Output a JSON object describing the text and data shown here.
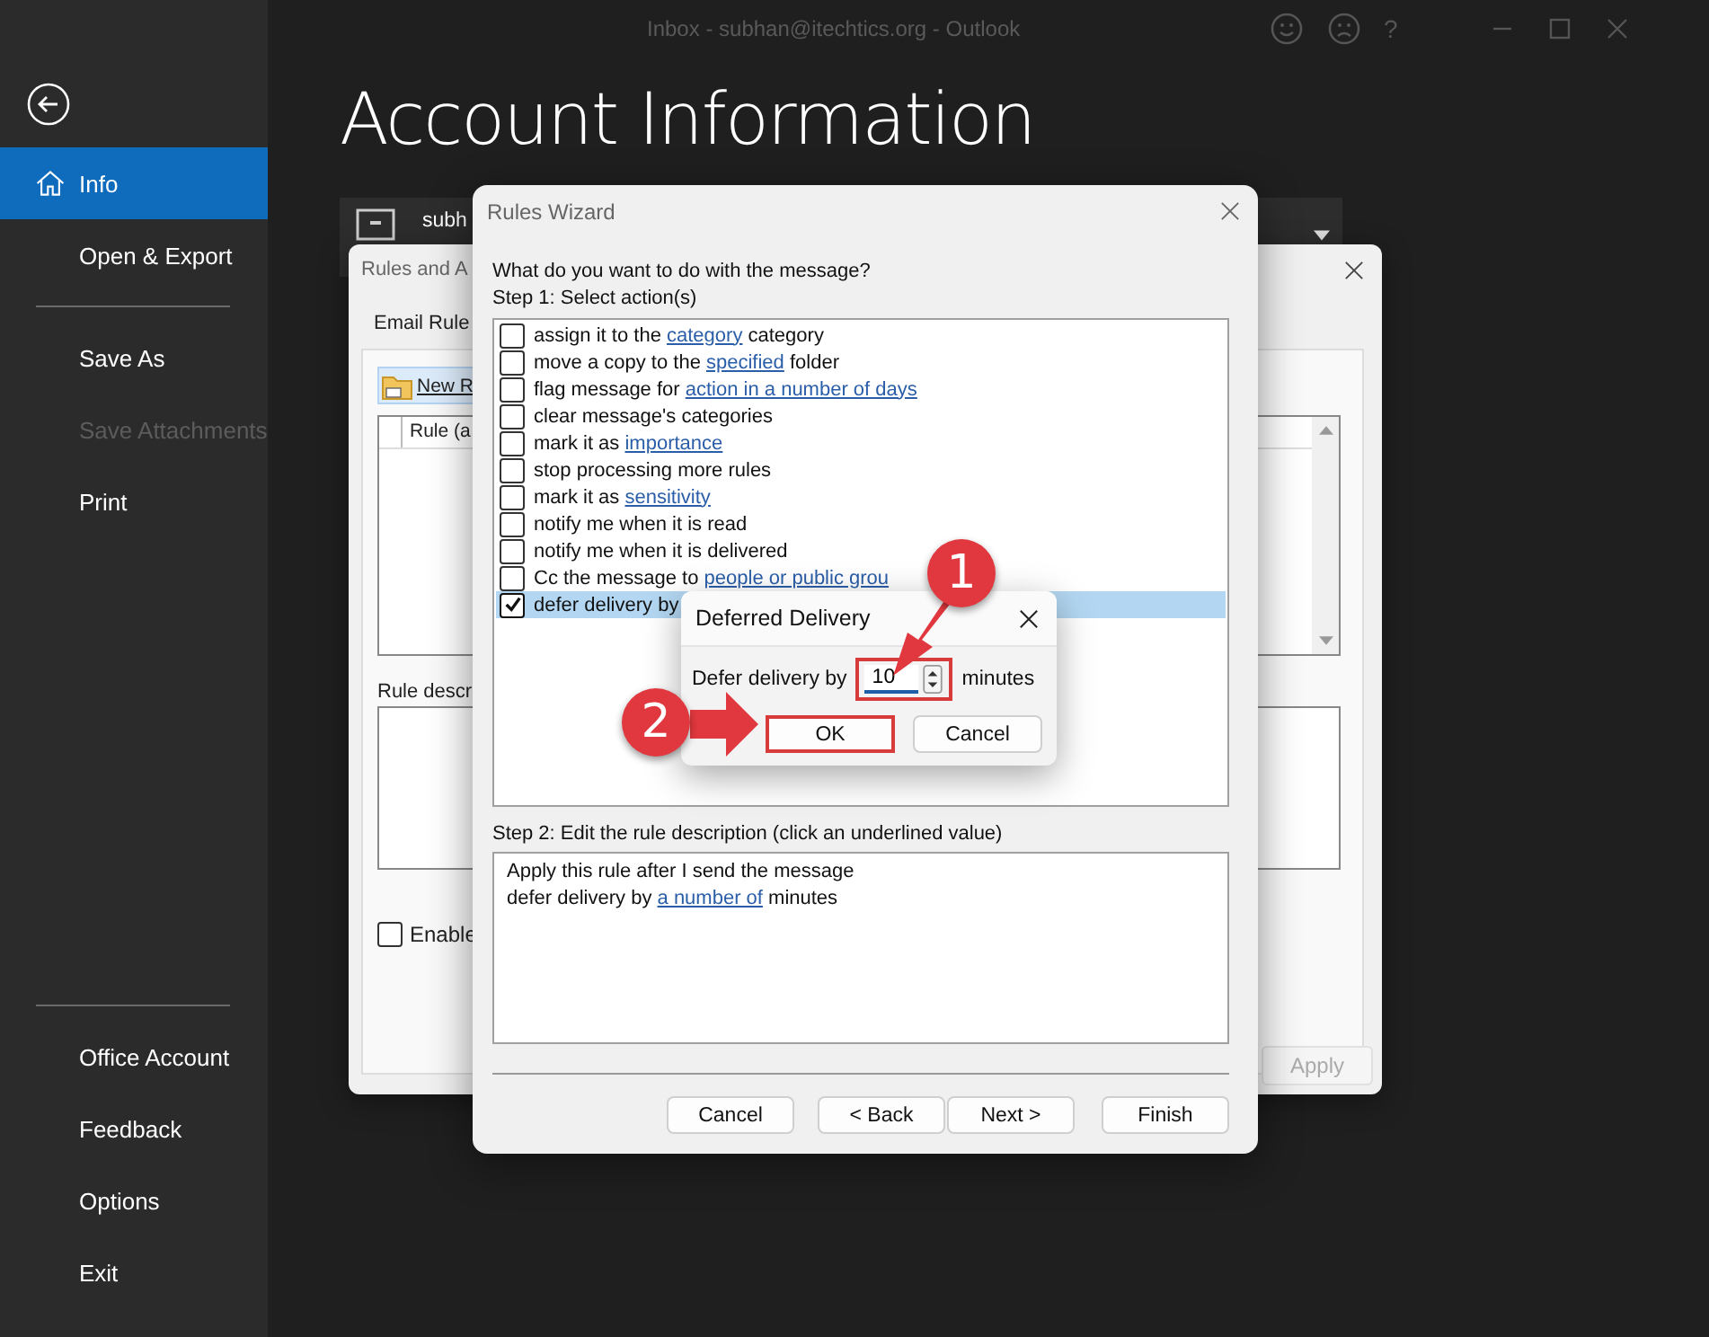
{
  "window": {
    "title": "Inbox - subhan@itechtics.org - Outlook",
    "help": "?"
  },
  "sidebar": {
    "sections": [
      [
        {
          "label": "Info",
          "selected": true,
          "disabled": false
        },
        {
          "label": "Open & Export",
          "selected": false,
          "disabled": false
        }
      ],
      [
        {
          "label": "Save As",
          "selected": false,
          "disabled": false
        },
        {
          "label": "Save Attachments",
          "selected": false,
          "disabled": true
        },
        {
          "label": "Print",
          "selected": false,
          "disabled": false
        }
      ],
      [
        {
          "label": "Office Account",
          "selected": false,
          "disabled": false
        },
        {
          "label": "Feedback",
          "selected": false,
          "disabled": false
        },
        {
          "label": "Options",
          "selected": false,
          "disabled": false
        },
        {
          "label": "Exit",
          "selected": false,
          "disabled": false
        }
      ]
    ]
  },
  "page_title": "Account Information",
  "account": {
    "name": "subh"
  },
  "rules_dialog": {
    "title": "Rules and A",
    "tab": "Email Rule",
    "new_button": "New R",
    "column": "Rule (a",
    "description_label": "Rule descr",
    "enable_label": "Enable",
    "enable_checked": false,
    "apply_button": "Apply"
  },
  "wizard": {
    "title": "Rules Wizard",
    "question": "What do you want to do with the message?",
    "step1": "Step 1: Select action(s)",
    "actions": [
      {
        "before": "assign it to the ",
        "link": "category",
        "after": " category",
        "checked": false,
        "selected": false
      },
      {
        "before": "move a copy to the ",
        "link": "specified",
        "after": " folder",
        "checked": false,
        "selected": false
      },
      {
        "before": "flag message for ",
        "link": "action in a number of days",
        "checked": false,
        "selected": false
      },
      {
        "before": "clear message's categories",
        "checked": false,
        "selected": false
      },
      {
        "before": "mark it as ",
        "link": "importance",
        "checked": false,
        "selected": false
      },
      {
        "before": "stop processing more rules",
        "checked": false,
        "selected": false
      },
      {
        "before": "mark it as ",
        "link": "sensitivity",
        "checked": false,
        "selected": false
      },
      {
        "before": "notify me when it is read",
        "checked": false,
        "selected": false
      },
      {
        "before": "notify me when it is delivered",
        "checked": false,
        "selected": false
      },
      {
        "before": "Cc the message to ",
        "link": "people or public grou",
        "checked": false,
        "selected": false
      },
      {
        "before": "defer delivery by",
        "checked": true,
        "selected": true
      }
    ],
    "step2": "Step 2: Edit the rule description (click an underlined value)",
    "description": [
      {
        "before": "Apply this rule after I send the message"
      },
      {
        "before": "defer delivery by ",
        "link": "a number of",
        "after": " minutes"
      }
    ],
    "buttons": [
      "Cancel",
      "< Back",
      "Next >",
      "Finish"
    ]
  },
  "deferred_dialog": {
    "title": "Deferred Delivery",
    "label": "Defer delivery by",
    "value": "10",
    "value_highlighted": true,
    "unit": "minutes",
    "ok": "OK",
    "ok_highlighted": true,
    "cancel": "Cancel"
  },
  "annotations": [
    {
      "label": "1"
    },
    {
      "label": "2"
    }
  ]
}
